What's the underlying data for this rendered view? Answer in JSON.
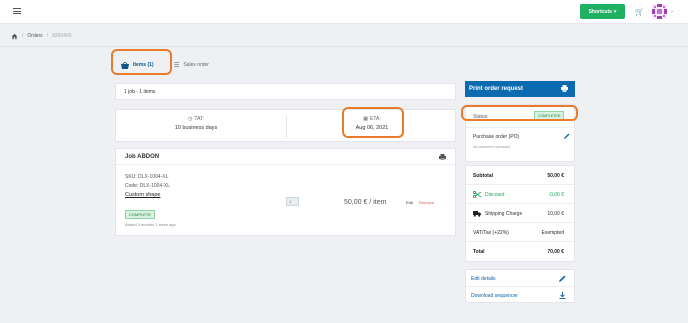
{
  "topbar": {
    "shortcuts_label": "Shortcuts",
    "colors": {
      "shortcuts_bg": "#1fb062",
      "accent": "#0c6bb0",
      "highlight": "#e87c2c"
    }
  },
  "breadcrumb": {
    "orders": "Orders",
    "order_id": "8200400"
  },
  "tabs": {
    "items_label": "Items (1)",
    "sales_label": "Sales order"
  },
  "main": {
    "jobs_summary": "1 job - 1 items",
    "tat_label": "TAT:",
    "tat_value": "10 business days",
    "eta_label": "ETA:",
    "eta_value": "Aug 06, 2021"
  },
  "job": {
    "title": "Job ABDON",
    "sku": "SKU: DLX-1004-XL",
    "code": "Code: DLX-1004-XL",
    "custom_shape": "Custom shape",
    "status": "COMPLETE",
    "added": "Added 3 months 1 week ago",
    "quantity": "1",
    "price": "50,00 € / item",
    "edit_label": "Edit",
    "remove_label": "Remove"
  },
  "sidebar": {
    "print_request_label": "Print order request",
    "status_label": "Status:",
    "status_value": "COMPLETED",
    "po_label": "Purchase order (PO)",
    "po_sub": "No document uploaded",
    "totals": [
      {
        "label": "Subtotal",
        "value": "50,00 €"
      },
      {
        "label": "Discount",
        "value": "-0,00 €"
      },
      {
        "label": "Shipping Charge",
        "value": "10,00 €"
      },
      {
        "label": "VAT/Tax (+22%)",
        "value": "Exempted"
      },
      {
        "label": "Total",
        "value": "70,00 €"
      }
    ],
    "edit_details_label": "Edit details",
    "download_label": "Download sequencer"
  }
}
